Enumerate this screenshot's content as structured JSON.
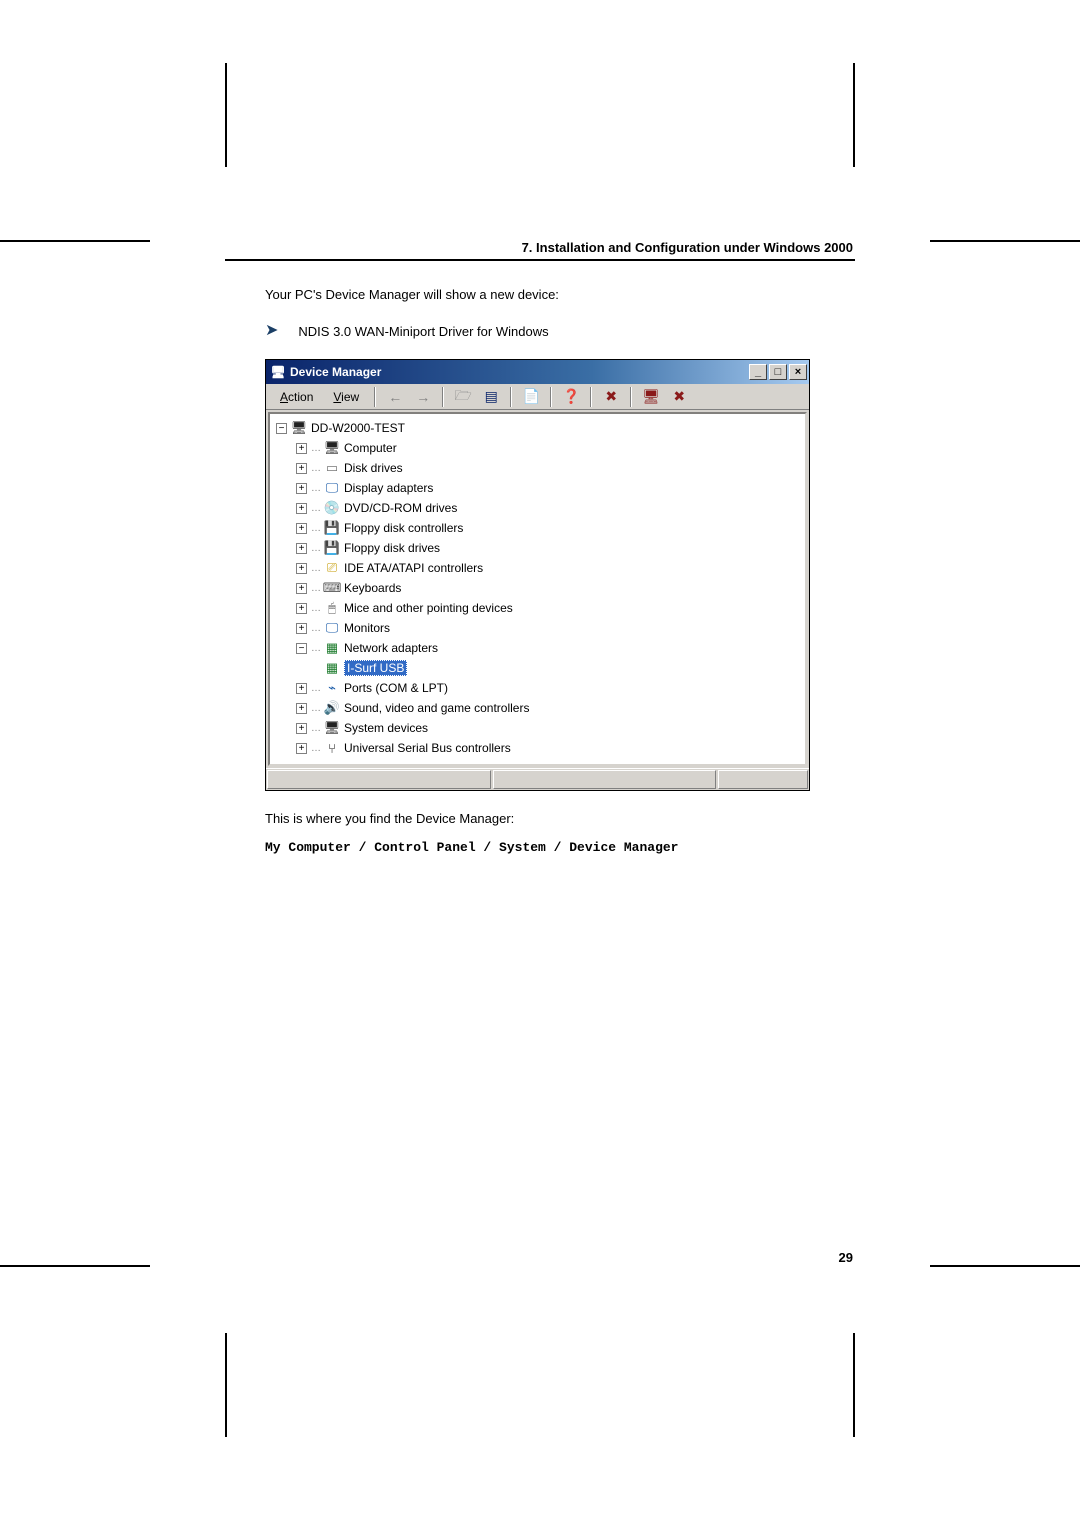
{
  "page": {
    "chapter_title": "7. Installation and Configuration under Windows 2000",
    "intro": "Your PC's Device Manager will show a new device:",
    "bullet": "NDIS 3.0 WAN-Miniport Driver for Windows",
    "after": "This is where you find the Device Manager:",
    "path": "My Computer / Control Panel / System / Device Manager",
    "number": "29"
  },
  "dm": {
    "title": "Device Manager",
    "menu": {
      "action": "Action",
      "view": "View"
    },
    "win_buttons": {
      "min": "_",
      "max": "□",
      "close": "×"
    },
    "toolbar": {
      "back": "←",
      "fwd": "→",
      "folder": "🗁",
      "list": "▤",
      "props": "📄",
      "help": "❓",
      "stop": "✖",
      "scan": "🖥",
      "remove": "✖"
    },
    "tree": {
      "root": {
        "box": "−",
        "label": "DD-W2000-TEST"
      },
      "computer": {
        "box": "+",
        "label": "Computer"
      },
      "disk": {
        "box": "+",
        "label": "Disk drives"
      },
      "display": {
        "box": "+",
        "label": "Display adapters"
      },
      "dvd": {
        "box": "+",
        "label": "DVD/CD-ROM drives"
      },
      "floppy_ctrl": {
        "box": "+",
        "label": "Floppy disk controllers"
      },
      "floppy_drv": {
        "box": "+",
        "label": "Floppy disk drives"
      },
      "ide": {
        "box": "+",
        "label": "IDE ATA/ATAPI controllers"
      },
      "keyb": {
        "box": "+",
        "label": "Keyboards"
      },
      "mice": {
        "box": "+",
        "label": "Mice and other pointing devices"
      },
      "mon": {
        "box": "+",
        "label": "Monitors"
      },
      "net": {
        "box": "−",
        "label": "Network adapters"
      },
      "isurf": {
        "label": "I-Surf USB"
      },
      "ports": {
        "box": "+",
        "label": "Ports (COM & LPT)"
      },
      "sound": {
        "box": "+",
        "label": "Sound, video and game controllers"
      },
      "sys": {
        "box": "+",
        "label": "System devices"
      },
      "usb": {
        "box": "+",
        "label": "Universal Serial Bus controllers"
      }
    }
  }
}
